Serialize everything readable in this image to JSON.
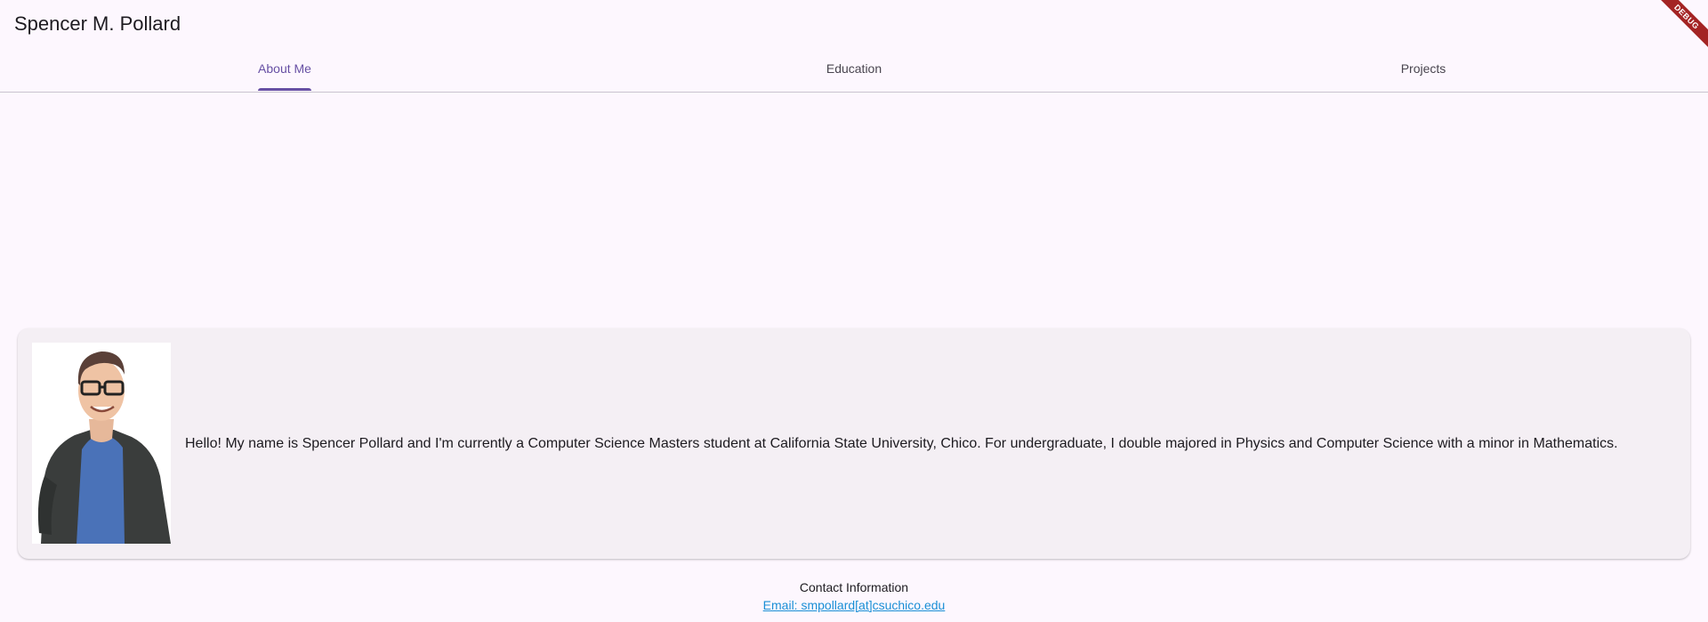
{
  "app_bar": {
    "title": "Spencer M. Pollard"
  },
  "debug_banner": {
    "label": "DEBUG"
  },
  "tabs": [
    {
      "label": "About Me",
      "active": true
    },
    {
      "label": "Education",
      "active": false
    },
    {
      "label": "Projects",
      "active": false
    }
  ],
  "about": {
    "text": "Hello! My name is Spencer Pollard and I'm currently a Computer Science Masters student at California State University, Chico. For undergraduate, I double majored in Physics and Computer Science with a minor in Mathematics."
  },
  "contact": {
    "heading": "Contact Information",
    "email_link": "Email: smpollard[at]csuchico.edu"
  },
  "colors": {
    "background": "#fdf7fe",
    "accent": "#6750a4",
    "card": "#f4eff4",
    "link": "#1a8fd6",
    "debug_ribbon": "#a42424"
  }
}
